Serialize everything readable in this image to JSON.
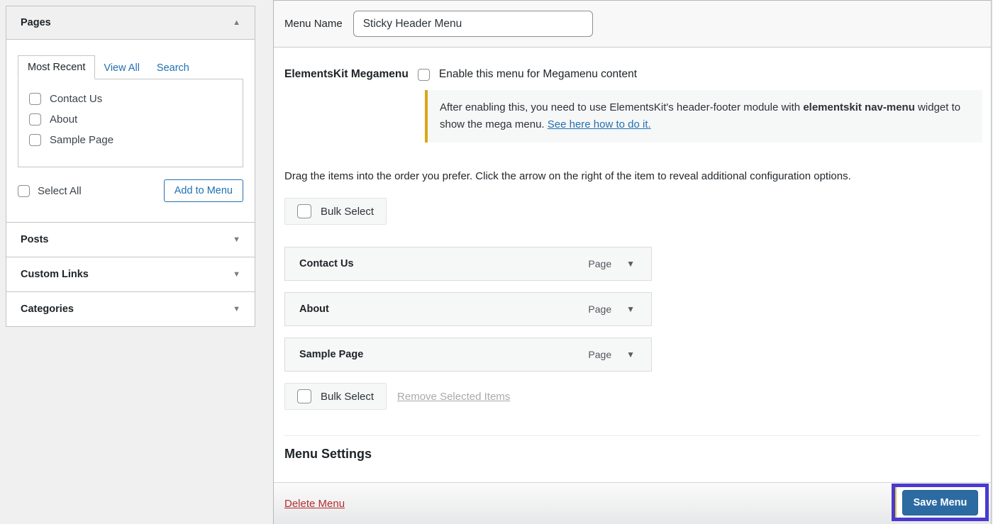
{
  "colors": {
    "accent_blue": "#2271b1",
    "warning_yellow": "#dba617",
    "delete_red": "#b32d2e",
    "save_button_blue": "#2c6ba2",
    "highlight_purple": "#4a3ad0"
  },
  "icons": {
    "collapse": "▲",
    "expand": "▼",
    "dropdown": "▼"
  },
  "sidebar": {
    "pages": {
      "title": "Pages",
      "tabs": {
        "most_recent": "Most Recent",
        "view_all": "View All",
        "search": "Search"
      },
      "items": [
        {
          "label": "Contact Us"
        },
        {
          "label": "About"
        },
        {
          "label": "Sample Page"
        }
      ],
      "select_all_label": "Select All",
      "add_button_label": "Add to Menu"
    },
    "sections": [
      {
        "title": "Posts"
      },
      {
        "title": "Custom Links"
      },
      {
        "title": "Categories"
      }
    ]
  },
  "main": {
    "menu_name_label": "Menu Name",
    "menu_name_value": "Sticky Header Menu",
    "megamenu": {
      "label": "ElementsKit Megamenu",
      "checkbox_label": "Enable this menu for Megamenu content",
      "notice": {
        "text_before": "After enabling this, you need to use ElementsKit's header-footer module with ",
        "bold_text": "elementskit nav-menu",
        "text_after": " widget to show the mega menu. ",
        "link_text": "See here how to do it."
      }
    },
    "instruction": "Drag the items into the order you prefer. Click the arrow on the right of the item to reveal additional configuration options.",
    "bulk_select_label": "Bulk Select",
    "menu_items": [
      {
        "title": "Contact Us",
        "type": "Page"
      },
      {
        "title": "About",
        "type": "Page"
      },
      {
        "title": "Sample Page",
        "type": "Page"
      }
    ],
    "remove_selected_label": "Remove Selected Items",
    "menu_settings_heading": "Menu Settings",
    "footer": {
      "delete_label": "Delete Menu",
      "save_label": "Save Menu"
    }
  }
}
